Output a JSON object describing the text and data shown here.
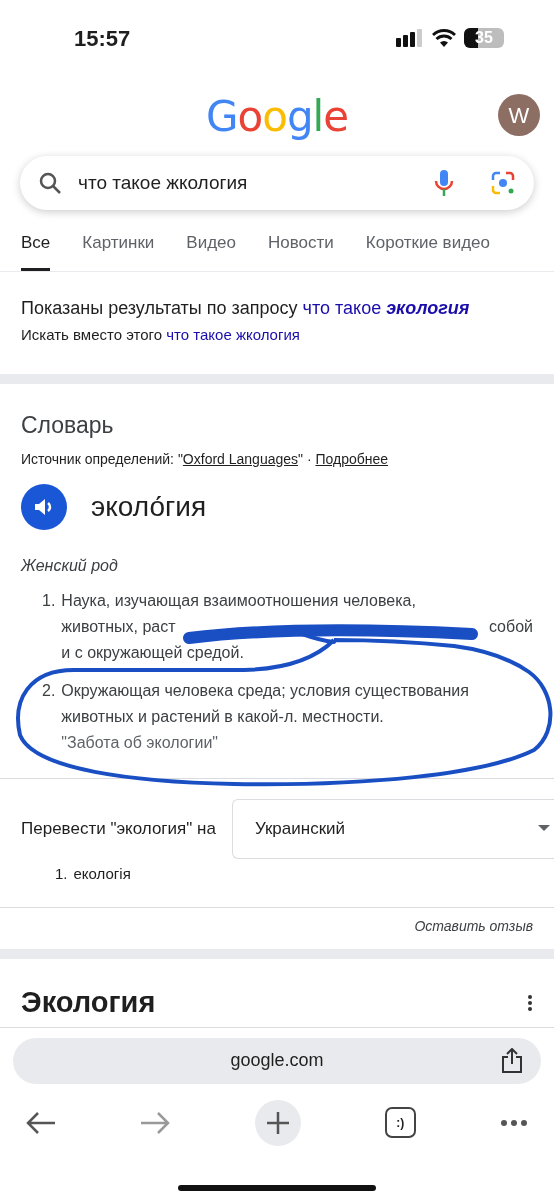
{
  "status_bar": {
    "time": "15:57",
    "battery": "35"
  },
  "header": {
    "logo": "Google",
    "avatar": "W"
  },
  "search": {
    "value": "что такое жкология"
  },
  "tabs": [
    {
      "label": "Все",
      "selected": true
    },
    {
      "label": "Картинки",
      "selected": false
    },
    {
      "label": "Видео",
      "selected": false
    },
    {
      "label": "Новости",
      "selected": false
    },
    {
      "label": "Короткие видео",
      "selected": false
    }
  ],
  "correction": {
    "text": "Показаны результаты по запросу",
    "link": "что такое **экология**",
    "instead_text": "Искать вместо этого",
    "instead_link": "что такое жкология"
  },
  "dictionary": {
    "title": "Словарь",
    "source_label": "Источник определений: \"",
    "source_link": "Oxford Languages",
    "source_sep": "\" ·",
    "more_link": "Подробнее",
    "word": "эколо́гия",
    "gender": "Женский род",
    "definitions": [
      {
        "number": "1.",
        "lines": [
          [
            "Наука, изучающая взаимоотношения человека,"
          ],
          [
            "животных, раст",
            "собой"
          ],
          [
            "и с окружающей средой."
          ]
        ]
      },
      {
        "number": "2.",
        "lines": [
          [
            "Окружающая человека среда; условия существования"
          ],
          [
            "животных и растений в какой-л. местности."
          ]
        ],
        "example": "\"Забота об экологии\""
      }
    ]
  },
  "translate": {
    "label": "Перевести \"экология\" на",
    "language": "Украинский",
    "results": [
      {
        "number": "1.",
        "text": "екологія"
      }
    ]
  },
  "feedback": "Оставить отзыв",
  "next_section": {
    "title": "Экология"
  },
  "browser": {
    "url": "google.com",
    "tabs_label": ":)"
  }
}
